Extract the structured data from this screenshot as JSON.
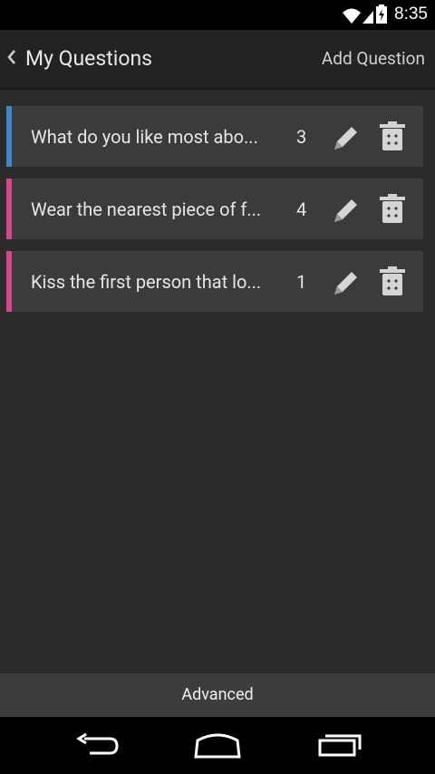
{
  "status": {
    "time": "8:35"
  },
  "actionbar": {
    "title": "My Questions",
    "add_label": "Add Question"
  },
  "questions": [
    {
      "text": "What do you like most abo...",
      "count": "3",
      "color": "#3f86c9"
    },
    {
      "text": "Wear the nearest piece of f...",
      "count": "4",
      "color": "#d9448f"
    },
    {
      "text": "Kiss the first person that lo...",
      "count": "1",
      "color": "#d9448f"
    }
  ],
  "footer": {
    "advanced_label": "Advanced"
  },
  "icons": {
    "back": "chevron-left-icon",
    "edit": "pencil-icon",
    "delete": "trash-icon",
    "nav_back": "back-arrow-icon",
    "nav_home": "home-icon",
    "nav_recents": "recents-icon"
  }
}
